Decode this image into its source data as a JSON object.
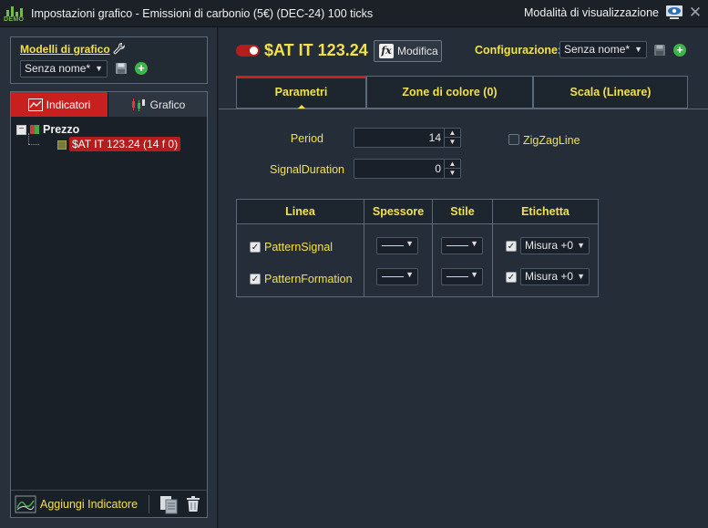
{
  "window": {
    "title": "Impostazioni grafico - Emissioni di carbonio (5€) (DEC-24) 100 ticks",
    "logo_text": "DEMO",
    "view_mode_label": "Modalità di visualizzazione"
  },
  "left": {
    "models_title": "Modelli di grafico",
    "models_select": "Senza nome*",
    "tabs": {
      "indicators": "Indicatori",
      "chart": "Grafico"
    },
    "tree": {
      "root": "Prezzo",
      "child": "$AT IT 123.24 (14 f 0)"
    },
    "footer": {
      "add_indicator": "Aggiungi Indicatore"
    }
  },
  "right": {
    "symbol_title": "$AT IT 123.24",
    "modify_button": "Modifica",
    "config_label": "Configurazione:",
    "config_select": "Senza nome*",
    "tabs": [
      "Parametri",
      "Zone di colore (0)",
      "Scala (Lineare)"
    ],
    "params": {
      "period_label": "Period",
      "period_value": "14",
      "signal_label": "SignalDuration",
      "signal_value": "0",
      "zigzag_label": "ZigZagLine",
      "zigzag_checked": false
    },
    "grid": {
      "headers": [
        "Linea",
        "Spessore",
        "Stile",
        "Etichetta"
      ],
      "rows": [
        {
          "name": "PatternSignal",
          "checked": true,
          "label_checked": true,
          "label": "Misura +0",
          "color": "#f3e14a"
        },
        {
          "name": "PatternFormation",
          "checked": true,
          "label_checked": true,
          "label": "Misura +0",
          "color": "#f3e14a"
        }
      ]
    }
  },
  "colors": {
    "accent_yellow": "#f3e14a",
    "active_red": "#c8201f",
    "add_green": "#3fb34a"
  }
}
